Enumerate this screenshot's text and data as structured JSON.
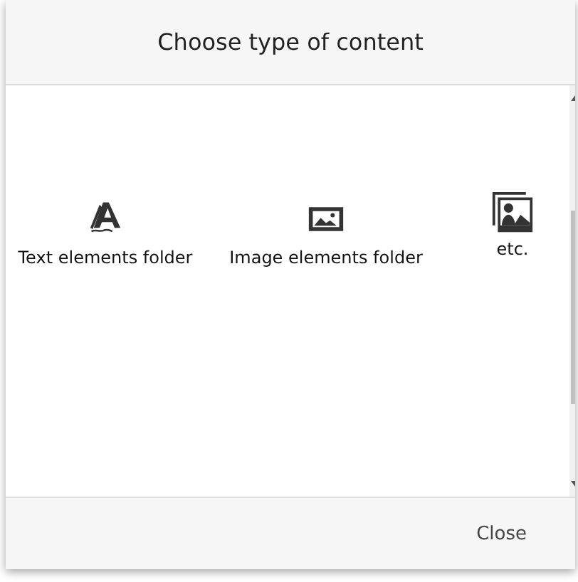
{
  "dialog": {
    "title": "Choose type of content"
  },
  "items": [
    {
      "kind": "text",
      "label": "Text elements folder"
    },
    {
      "kind": "image",
      "label": "Image elements folder"
    },
    {
      "kind": "gallery",
      "label": "etc."
    }
  ],
  "footer": {
    "close": "Close"
  }
}
